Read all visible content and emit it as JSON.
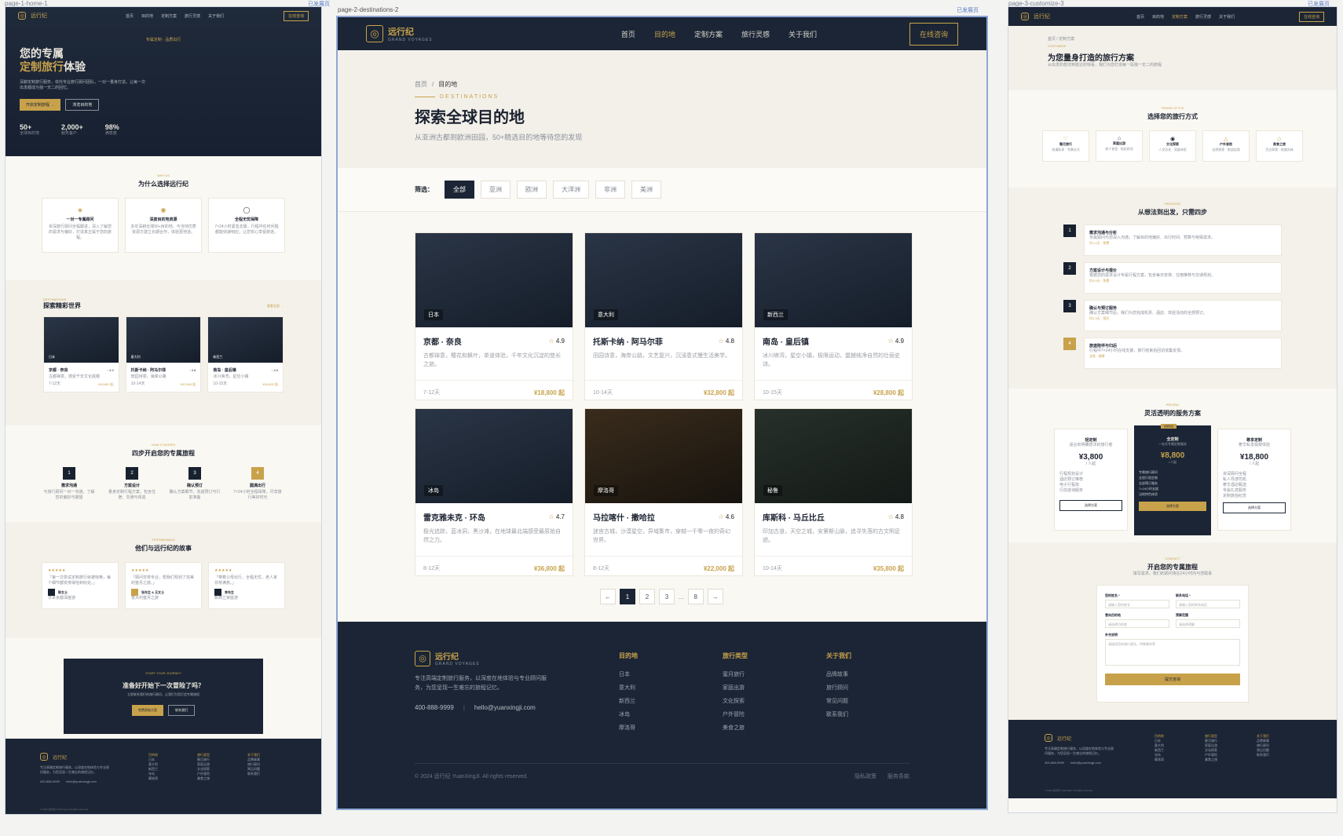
{
  "labels": {
    "left": "page-1-home-1",
    "middle": "page-2-destinations-2",
    "right": "page-3-customize-3",
    "badge": "已发展页"
  },
  "brand": {
    "name": "远行纪",
    "sub": "GRAND VOYAGES",
    "mark": "◎"
  },
  "nav": {
    "items": [
      "首页",
      "目的地",
      "定制方案",
      "旅行灵感",
      "关于我们"
    ],
    "cta": "在线咨询"
  },
  "home": {
    "hero_kicker": "专属定制 · 品质出行",
    "hero_title1": "您的专属",
    "hero_title2": "定制旅行",
    "hero_title3": "体验",
    "hero_desc": "深耕定制旅行服务，依托专业旅行顾问团队，一对一量身打造，让每一次出发都成为独一无二的回忆。",
    "btn_primary": "开启定制旅程 →",
    "btn_secondary": "浏览目的地",
    "stats": [
      {
        "v": "50+",
        "l": "全球目的地"
      },
      {
        "v": "2,000+",
        "l": "服务客户"
      },
      {
        "v": "98%",
        "l": "满意度"
      }
    ],
    "why_kicker": "WHY US",
    "why_title": "为什么选择远行纪",
    "why": [
      {
        "t": "一对一专属顾问",
        "d": "资深旅行顾问全程跟进，深入了解您的需求与偏好，打造真正属于您的旅程。"
      },
      {
        "t": "深度目的地资源",
        "d": "多年深耕全球50+目的地，与当地优质资源方建立长期合作，体验更地道。"
      },
      {
        "t": "全程无忧保障",
        "d": "7×24小时紧急支援，行程中任何问题都能快速响应，让您安心享受旅途。"
      }
    ],
    "explore_kicker": "DESTINATIONS",
    "explore_title": "探索精彩世界",
    "explore_more": "查看全部 →",
    "explore": [
      {
        "tag": "日本",
        "t": "京都 · 奈良",
        "r": "4.9",
        "d": "古都禅意，感受千年文化底蕴",
        "days": "7-12天",
        "p": "¥18,800 起"
      },
      {
        "tag": "意大利",
        "t": "托斯卡纳 · 阿马尔菲",
        "r": "4.8",
        "d": "田园诗意，海岸公路",
        "days": "10-14天",
        "p": "¥32,800 起"
      },
      {
        "tag": "新西兰",
        "t": "南岛 · 皇后镇",
        "r": "4.9",
        "d": "冰川峡湾，星空小镇",
        "days": "10-15天",
        "p": "¥28,800 起"
      }
    ],
    "steps_kicker": "HOW IT WORKS",
    "steps_title": "四步开启您的专属旅程",
    "steps": [
      {
        "n": "1",
        "t": "需求沟通",
        "d": "与旅行顾问一对一沟通，了解您的偏好与期望"
      },
      {
        "n": "2",
        "t": "方案设计",
        "d": "量身定制行程方案，包含住宿、交通与体验"
      },
      {
        "n": "3",
        "t": "确认预订",
        "d": "确认方案细节，完成预订与行前准备"
      },
      {
        "n": "4",
        "t": "圆满出行",
        "d": "7×24小时全程保障，尽享旅行美好时光"
      }
    ],
    "stories_kicker": "TESTIMONIALS",
    "stories_title": "他们与远行纪的故事",
    "stories": [
      {
        "q": "「第一次尝试定制旅行就被惊艳，每个细节都安排得恰到好处。」",
        "n": "陈女士",
        "s": "日本京都深度游"
      },
      {
        "q": "「顾问非常专业，帮我们规划了完美的蜜月之旅。」",
        "n": "张先生 & 王女士",
        "s": "意大利蜜月之旅"
      },
      {
        "q": "「带着父母出行，全程无忧，老人家非常满意。」",
        "n": "李先生",
        "s": "新西兰家庭游"
      }
    ],
    "cta_kicker": "START YOUR JOURNEY",
    "cta_title": "准备好开始下一次冒险了吗？",
    "cta_desc": "立即联系我们的旅行顾问，让我们为您打造专属旅程",
    "cta_btn1": "免费获取方案",
    "cta_btn2": "联系我们"
  },
  "dest": {
    "crumb_home": "首页",
    "crumb_sep": "/",
    "crumb_cur": "目的地",
    "kicker": "DESTINATIONS",
    "title": "探索全球目的地",
    "subtitle": "从亚洲古都到欧洲田园，50+精选目的地等待您的发现",
    "filter_label": "筛选：",
    "filters": [
      "全部",
      "亚洲",
      "欧洲",
      "大洋洲",
      "非洲",
      "美洲"
    ],
    "cards": [
      {
        "tag": "日本",
        "title": "京都 · 奈良",
        "rating": "4.9",
        "desc": "古都禅意，樱花和枫叶，茶道体验，千年文化沉淀的悠长之旅。",
        "days": "7-12天",
        "price": "¥18,800 起"
      },
      {
        "tag": "意大利",
        "title": "托斯卡纳 · 阿马尔菲",
        "rating": "4.8",
        "desc": "田园诗意，海岸公路，文艺复兴，沉浸意式慢生活美学。",
        "days": "10-14天",
        "price": "¥32,800 起"
      },
      {
        "tag": "新西兰",
        "title": "南岛 · 皇后镇",
        "rating": "4.9",
        "desc": "冰川峡湾，星空小镇，极限运动，震撼纯净自然的壮丽史诗。",
        "days": "10-15天",
        "price": "¥28,800 起"
      },
      {
        "tag": "冰岛",
        "title": "雷克雅未克 · 环岛",
        "rating": "4.7",
        "desc": "极光追踪，蓝冰洞，黑沙滩，在地球最北端感受最原始自然之力。",
        "days": "8-12天",
        "price": "¥36,800 起"
      },
      {
        "tag": "摩洛哥",
        "title": "马拉喀什 · 撒哈拉",
        "rating": "4.6",
        "desc": "迷宫古城，沙漠星空，异域集市，穿越一千零一夜的奇幻世界。",
        "days": "8-12天",
        "price": "¥22,000 起"
      },
      {
        "tag": "秘鲁",
        "title": "库斯科 · 马丘比丘",
        "rating": "4.8",
        "desc": "印加古道，天空之城，安第斯山脉，追寻失落的古文明足迹。",
        "days": "10-14天",
        "price": "¥35,800 起"
      }
    ],
    "pages": [
      "←",
      "1",
      "2",
      "3",
      "...",
      "8",
      "→"
    ],
    "footer_desc": "专注高端定制旅行服务，以深度在地体验与专业顾问服务，为您呈现一生难忘的旅程记忆。",
    "phone": "400-888-9999",
    "email": "hello@yuanxingji.com",
    "cols": [
      {
        "h": "目的地",
        "items": [
          "日本",
          "意大利",
          "新西兰",
          "冰岛",
          "摩洛哥"
        ]
      },
      {
        "h": "旅行类型",
        "items": [
          "蜜月旅行",
          "家庭出游",
          "文化探索",
          "户外冒险",
          "美食之旅"
        ]
      },
      {
        "h": "关于我们",
        "items": [
          "品牌故事",
          "旅行顾问",
          "常见问题",
          "联系我们"
        ]
      }
    ],
    "copyright": "© 2024 远行纪 YuanXingJi. All rights reserved.",
    "legal": [
      "隐私政策",
      "服务条款"
    ]
  },
  "custom": {
    "crumb": "首页 / 定制方案",
    "kicker": "CUSTOMIZE",
    "title": "为您量身打造的旅行方案",
    "subtitle": "从出发的想法到抵达的惊喜，我们为您打造每一段独一无二的旅程",
    "ways_kicker": "TRAVEL STYLE",
    "ways_title": "选择您的旅行方式",
    "ways": [
      {
        "t": "蜜月旅行",
        "d": "浪漫私享 · 专属仪式"
      },
      {
        "t": "家庭出游",
        "d": "老少皆宜 · 轻松舒适"
      },
      {
        "t": "文化探索",
        "d": "人文历史 · 深度体验"
      },
      {
        "t": "户外冒险",
        "d": "自然探索 · 挑战自我"
      },
      {
        "t": "美食之旅",
        "d": "舌尖探索 · 地道风味"
      }
    ],
    "steps_kicker": "PROCESS",
    "steps_title": "从想法到出发，只需四步",
    "steps": [
      {
        "n": "1",
        "t": "需求沟通与分析",
        "d": "专属顾问与您深入沟通，了解目的地偏好、出行时间、预算与特殊需求。",
        "m": "约1-2天 · 免费"
      },
      {
        "n": "2",
        "t": "方案设计与报价",
        "d": "根据您的需求设计专属行程方案，包含每日安排、住宿推荐与交通规划。",
        "m": "约3-5天 · 免费"
      },
      {
        "n": "3",
        "t": "确认与预订服务",
        "d": "确认方案细节后，我们为您完成机票、酒店、体验活动的全部预订。",
        "m": "约2-3天 · 签约"
      },
      {
        "n": "4",
        "t": "旅途陪伴与归后",
        "d": "行程中7×24小时在线支援，旅行结束后回访收集反馈。",
        "m": "全程 · 保障"
      }
    ],
    "plans_kicker": "PRICING",
    "plans_title": "灵活透明的服务方案",
    "plans": [
      {
        "t": "轻定制",
        "s": "适合有明确想法的旅行者",
        "p": "¥3,800",
        "u": "/ 人起",
        "items": [
          "行程规划设计",
          "酒店预订推荐",
          "电子行程单",
          "行前咨询服务"
        ],
        "btn": "选择方案"
      },
      {
        "t": "全定制",
        "s": "一站式专属定制服务",
        "p": "¥8,800",
        "u": "/ 人起",
        "badge": "最受欢迎",
        "items": [
          "专属旅行顾问",
          "全程行程定制",
          "全部预订服务",
          "7×24小时支援",
          "当地特色体验"
        ],
        "btn": "选择方案"
      },
      {
        "t": "尊享定制",
        "s": "奢华私享极致体验",
        "p": "¥18,800",
        "u": "/ 人起",
        "items": [
          "资深顾问全程",
          "私人导游司机",
          "奢华酒店甄选",
          "专属礼宾服务",
          "定制旅拍纪念"
        ],
        "btn": "选择方案"
      }
    ],
    "form_kicker": "CONTACT",
    "form_title": "开启您的专属旅程",
    "form_desc": "填写需求，我们的顾问将在24小时内与您联系",
    "f_name": "您的姓名 *",
    "f_name_ph": "请输入您的姓名",
    "f_phone": "联系电话 *",
    "f_phone_ph": "请输入您的联系电话",
    "f_dest": "意向目的地",
    "f_dest_val": "请选择目的地",
    "f_budget": "预算范围",
    "f_budget_val": "请选择预算",
    "f_note": "补充说明",
    "f_note_ph": "请描述您的旅行想法、特殊需求等",
    "f_submit": "提交咨询"
  }
}
